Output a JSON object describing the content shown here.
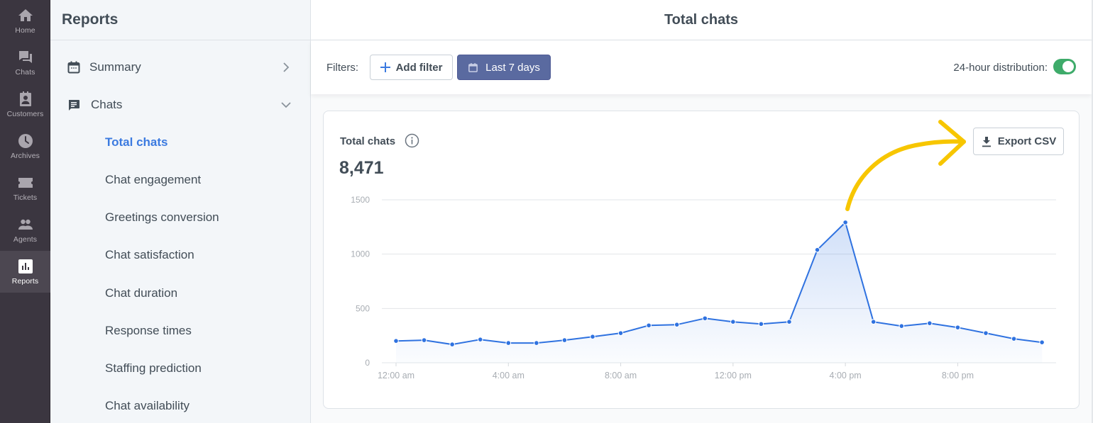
{
  "rail": {
    "items": [
      {
        "label": "Home",
        "icon": "home-icon"
      },
      {
        "label": "Chats",
        "icon": "chats-icon"
      },
      {
        "label": "Customers",
        "icon": "customers-icon"
      },
      {
        "label": "Archives",
        "icon": "archives-icon"
      },
      {
        "label": "Tickets",
        "icon": "tickets-icon"
      },
      {
        "label": "Agents",
        "icon": "agents-icon"
      },
      {
        "label": "Reports",
        "icon": "reports-icon",
        "active": true
      }
    ]
  },
  "sidebar": {
    "title": "Reports",
    "sections": [
      {
        "label": "Summary",
        "icon": "calendar-icon",
        "expanded": false
      },
      {
        "label": "Chats",
        "icon": "chat-bubble-icon",
        "expanded": true
      }
    ],
    "chat_items": [
      {
        "label": "Total chats",
        "active": true
      },
      {
        "label": "Chat engagement"
      },
      {
        "label": "Greetings conversion"
      },
      {
        "label": "Chat satisfaction"
      },
      {
        "label": "Chat duration"
      },
      {
        "label": "Response times"
      },
      {
        "label": "Staffing prediction"
      },
      {
        "label": "Chat availability"
      }
    ]
  },
  "main": {
    "title": "Total chats",
    "filters": {
      "label": "Filters:",
      "add_filter_label": "Add filter",
      "date_range_label": "Last 7 days"
    },
    "distribution": {
      "label": "24-hour distribution:",
      "enabled": true
    },
    "card": {
      "title": "Total chats",
      "value": "8,471",
      "export_label": "Export CSV"
    }
  },
  "colors": {
    "accent": "#3b7ae0",
    "line": "#2f72e0",
    "date_button": "#5a6aa0",
    "toggle_on": "#3eab6a",
    "annotation_arrow": "#f7c600",
    "rail_bg": "#3b3640"
  },
  "chart_data": {
    "type": "area",
    "title": "Total chats",
    "xlabel": "",
    "ylabel": "",
    "ylim": [
      0,
      1500
    ],
    "yticks": [
      0,
      500,
      1000,
      1500
    ],
    "x": [
      "12:00 am",
      "1:00 am",
      "2:00 am",
      "3:00 am",
      "4:00 am",
      "5:00 am",
      "6:00 am",
      "7:00 am",
      "8:00 am",
      "9:00 am",
      "10:00 am",
      "11:00 am",
      "12:00 pm",
      "1:00 pm",
      "2:00 pm",
      "3:00 pm",
      "4:00 pm",
      "5:00 pm",
      "6:00 pm",
      "7:00 pm",
      "8:00 pm",
      "9:00 pm",
      "10:00 pm",
      "11:00 pm"
    ],
    "xtick_labels": [
      "12:00 am",
      "4:00 am",
      "8:00 am",
      "12:00 pm",
      "4:00 pm",
      "8:00 pm"
    ],
    "xtick_indices": [
      0,
      4,
      8,
      12,
      16,
      20
    ],
    "series": [
      {
        "name": "Total chats",
        "values": [
          201,
          208,
          169,
          214,
          182,
          182,
          208,
          240,
          273,
          344,
          351,
          409,
          377,
          357,
          377,
          1039,
          1292,
          377,
          338,
          364,
          325,
          273,
          221,
          188
        ]
      }
    ],
    "grid": true,
    "legend": "none"
  }
}
